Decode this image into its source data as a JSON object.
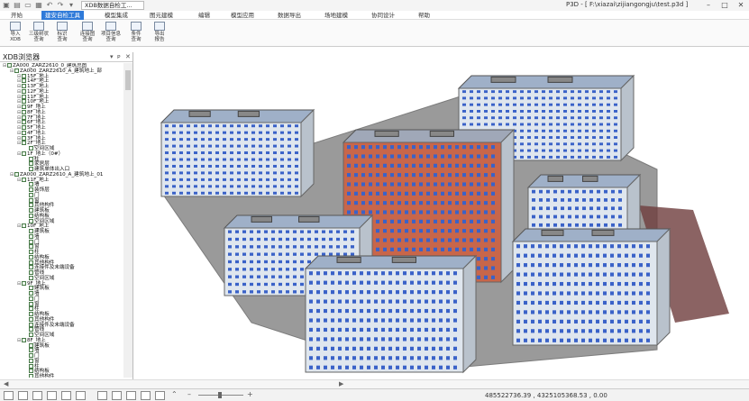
{
  "window": {
    "title": "P3D - [ F:\\xiazai\\zijiangongju\\test.p3d ]",
    "doc_tab": "XDB数据自检工..."
  },
  "menu": [
    "开始",
    "建安自检工具",
    "模型集成",
    "图元建模",
    "编辑",
    "模型应用",
    "数据导出",
    "场地建模",
    "协同设计",
    "帮助"
  ],
  "ribbon": [
    {
      "label": "导入\nXDB",
      "icon": "import-icon"
    },
    {
      "label": "三级树状\n查询",
      "icon": "tree-query-icon"
    },
    {
      "label": "标识\n查询",
      "icon": "id-query-icon"
    },
    {
      "label": "连接图\n查询",
      "icon": "connection-query-icon"
    },
    {
      "label": "项目信息\n查询",
      "icon": "project-info-icon"
    },
    {
      "label": "条件\n查询",
      "icon": "condition-query-icon"
    },
    {
      "label": "导出\n报告",
      "icon": "export-report-icon"
    }
  ],
  "panel": {
    "title": "XDB浏览器",
    "tree": [
      {
        "d": 0,
        "t": "ZA000_ZARZ2610_0_建筑总图"
      },
      {
        "d": 1,
        "t": "ZA000_ZARZ2610_A_建筑地上_部"
      },
      {
        "d": 2,
        "t": "15F_地上"
      },
      {
        "d": 2,
        "t": "14F_地上"
      },
      {
        "d": 2,
        "t": "13F_地上"
      },
      {
        "d": 2,
        "t": "12F_地上"
      },
      {
        "d": 2,
        "t": "11F_地上"
      },
      {
        "d": 2,
        "t": "10F_地上"
      },
      {
        "d": 2,
        "t": "9F_地上"
      },
      {
        "d": 2,
        "t": "8F_地上"
      },
      {
        "d": 2,
        "t": "7F_地上"
      },
      {
        "d": 2,
        "t": "6F_地上"
      },
      {
        "d": 2,
        "t": "5F_地上"
      },
      {
        "d": 2,
        "t": "4F_地上"
      },
      {
        "d": 2,
        "t": "3F_地上"
      },
      {
        "d": 2,
        "t": "2F_地上"
      },
      {
        "d": 3,
        "t": "空间区域"
      },
      {
        "d": 2,
        "t": "1F_地上（0#）"
      },
      {
        "d": 3,
        "t": "柱"
      },
      {
        "d": 3,
        "t": "家居层"
      },
      {
        "d": 3,
        "t": "建筑单体出入口"
      },
      {
        "d": 1,
        "t": "ZA000_ZARZ2610_A_建筑地上_01"
      },
      {
        "d": 2,
        "t": "11F_地上"
      },
      {
        "d": 3,
        "t": "墙"
      },
      {
        "d": 3,
        "t": "装饰层"
      },
      {
        "d": 3,
        "t": "门"
      },
      {
        "d": 3,
        "t": "窗"
      },
      {
        "d": 3,
        "t": "其他构件"
      },
      {
        "d": 3,
        "t": "建筑板"
      },
      {
        "d": 3,
        "t": "结构板"
      },
      {
        "d": 3,
        "t": "空间区域"
      },
      {
        "d": 2,
        "t": "10F_地上"
      },
      {
        "d": 3,
        "t": "建筑板"
      },
      {
        "d": 3,
        "t": "墙"
      },
      {
        "d": 3,
        "t": "门"
      },
      {
        "d": 3,
        "t": "窗"
      },
      {
        "d": 3,
        "t": "柱"
      },
      {
        "d": 3,
        "t": "结构板"
      },
      {
        "d": 3,
        "t": "其他构件"
      },
      {
        "d": 3,
        "t": "连接件及末端设备"
      },
      {
        "d": 3,
        "t": "管线"
      },
      {
        "d": 3,
        "t": "空间区域"
      },
      {
        "d": 2,
        "t": "9F_地上"
      },
      {
        "d": 3,
        "t": "建筑板"
      },
      {
        "d": 3,
        "t": "墙"
      },
      {
        "d": 3,
        "t": "门"
      },
      {
        "d": 3,
        "t": "窗"
      },
      {
        "d": 3,
        "t": "柱"
      },
      {
        "d": 3,
        "t": "结构板"
      },
      {
        "d": 3,
        "t": "其他构件"
      },
      {
        "d": 3,
        "t": "连接件及末端设备"
      },
      {
        "d": 3,
        "t": "管线"
      },
      {
        "d": 3,
        "t": "空间区域"
      },
      {
        "d": 2,
        "t": "8F_地上"
      },
      {
        "d": 3,
        "t": "建筑板"
      },
      {
        "d": 3,
        "t": "墙"
      },
      {
        "d": 3,
        "t": "门"
      },
      {
        "d": 3,
        "t": "窗"
      },
      {
        "d": 3,
        "t": "柱"
      },
      {
        "d": 3,
        "t": "结构板"
      },
      {
        "d": 3,
        "t": "其他构件"
      }
    ]
  },
  "status": {
    "coords": "485522736.39 , 4325105368.53 , 0.00"
  },
  "colors": {
    "accent": "#2f7ad9",
    "ground": "#9a9a9a",
    "building_light": "#dfe6ee",
    "building_red": "#c8664a",
    "window_blue": "#3a62c8"
  }
}
